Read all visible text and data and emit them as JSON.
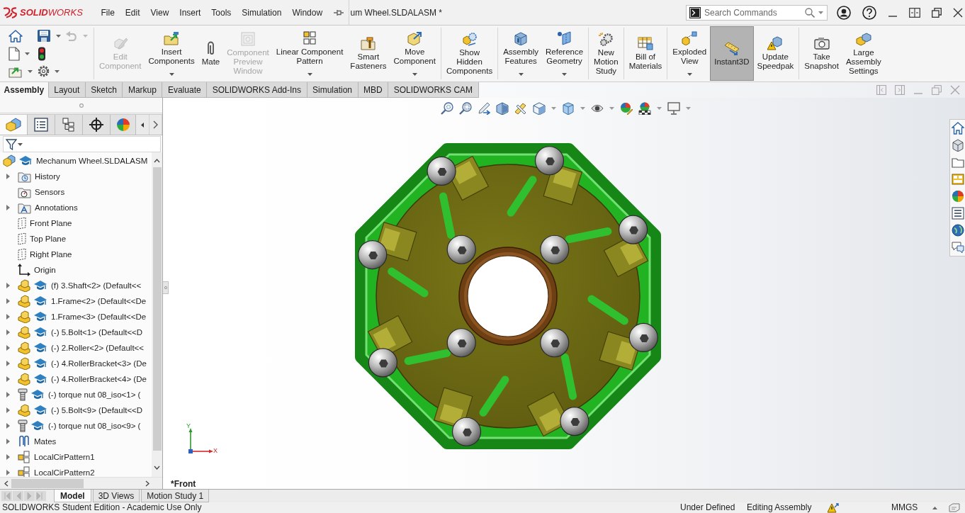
{
  "title_bar": {
    "app_name": "**SOLID**WORKS",
    "menu": [
      "File",
      "Edit",
      "View",
      "Insert",
      "Tools",
      "Simulation",
      "Window"
    ],
    "document_title": "um Wheel.SLDALASM *",
    "search": {
      "placeholder": "Search Commands"
    }
  },
  "quick_access": [
    [
      {
        "has_menu": false,
        "disabled": false
      },
      {
        "has_menu": true,
        "disabled": false
      },
      {
        "has_menu": true,
        "disabled": true
      }
    ],
    [
      {
        "has_menu": true,
        "disabled": false
      },
      {
        "has_menu": false,
        "disabled": false
      }
    ],
    [
      {
        "has_menu": true,
        "disabled": false
      },
      {
        "has_menu": true,
        "disabled": false
      }
    ]
  ],
  "command_groups": [
    [
      {
        "label": "Edit\nComponent",
        "disabled": true,
        "pressed": false,
        "has_menu": false
      },
      {
        "label": "Insert\nComponents",
        "disabled": false,
        "pressed": false,
        "has_menu": true
      },
      {
        "label": "Mate",
        "disabled": false,
        "pressed": false,
        "has_menu": false
      },
      {
        "label": "Component\nPreview\nWindow",
        "disabled": true,
        "pressed": false,
        "has_menu": false
      },
      {
        "label": "Linear Component\nPattern",
        "disabled": false,
        "pressed": false,
        "has_menu": true
      },
      {
        "label": "Smart\nFasteners",
        "disabled": false,
        "pressed": false,
        "has_menu": false
      },
      {
        "label": "Move\nComponent",
        "disabled": false,
        "pressed": false,
        "has_menu": true
      }
    ],
    [
      {
        "label": "Show\nHidden\nComponents",
        "disabled": false,
        "pressed": false,
        "has_menu": false
      }
    ],
    [
      {
        "label": "Assembly\nFeatures",
        "disabled": false,
        "pressed": false,
        "has_menu": true
      },
      {
        "label": "Reference\nGeometry",
        "disabled": false,
        "pressed": false,
        "has_menu": true
      }
    ],
    [
      {
        "label": "New\nMotion\nStudy",
        "disabled": false,
        "pressed": false,
        "has_menu": false
      }
    ],
    [
      {
        "label": "Bill of\nMaterials",
        "disabled": false,
        "pressed": false,
        "has_menu": false
      }
    ],
    [
      {
        "label": "Exploded\nView",
        "disabled": false,
        "pressed": false,
        "has_menu": true
      },
      {
        "label": "Instant3D",
        "disabled": false,
        "pressed": true,
        "has_menu": false
      },
      {
        "label": "Update\nSpeedpak",
        "disabled": false,
        "pressed": false,
        "has_menu": false
      }
    ],
    [
      {
        "label": "Take\nSnapshot",
        "disabled": false,
        "pressed": false,
        "has_menu": false
      },
      {
        "label": "Large\nAssembly\nSettings",
        "disabled": false,
        "pressed": false,
        "has_menu": false
      }
    ]
  ],
  "command_tabs": [
    {
      "label": "Assembly",
      "selected": true
    },
    {
      "label": "Layout",
      "selected": false
    },
    {
      "label": "Sketch",
      "selected": false
    },
    {
      "label": "Markup",
      "selected": false
    },
    {
      "label": "Evaluate",
      "selected": false
    },
    {
      "label": "SOLIDWORKS Add-Ins",
      "selected": false
    },
    {
      "label": "Simulation",
      "selected": false
    },
    {
      "label": "MBD",
      "selected": false
    },
    {
      "label": "SOLIDWORKS CAM",
      "selected": false
    }
  ],
  "feature_manager": {
    "panel_tabs": [
      {
        "selected": true
      },
      {
        "selected": false
      },
      {
        "selected": false
      },
      {
        "selected": false
      },
      {
        "selected": false
      }
    ],
    "tree": {
      "label": "Mechanum Wheel.SLDALASM",
      "kind": "assembly",
      "children": [
        {
          "label": "History",
          "kind": "history",
          "expandable": true
        },
        {
          "label": "Sensors",
          "kind": "sensors",
          "expandable": false
        },
        {
          "label": "Annotations",
          "kind": "annotations",
          "expandable": true
        },
        {
          "label": "Front Plane",
          "kind": "plane",
          "expandable": false
        },
        {
          "label": "Top Plane",
          "kind": "plane",
          "expandable": false
        },
        {
          "label": "Right Plane",
          "kind": "plane",
          "expandable": false
        },
        {
          "label": "Origin",
          "kind": "origin",
          "expandable": false
        },
        {
          "label": "(f) 3.Shaft<2> (Default<<",
          "kind": "part",
          "expandable": true
        },
        {
          "label": "1.Frame<2> (Default<<De",
          "kind": "part",
          "expandable": true
        },
        {
          "label": "1.Frame<3> (Default<<De",
          "kind": "part",
          "expandable": true
        },
        {
          "label": "(-) 5.Bolt<1> (Default<<D",
          "kind": "part",
          "expandable": true
        },
        {
          "label": "(-) 2.Roller<2> (Default<<",
          "kind": "part",
          "expandable": true
        },
        {
          "label": "(-) 4.RollerBracket<3> (De",
          "kind": "part",
          "expandable": true
        },
        {
          "label": "(-) 4.RollerBracket<4> (De",
          "kind": "part",
          "expandable": true
        },
        {
          "label": "(-) torque nut 08_iso<1> (",
          "kind": "hardware",
          "expandable": true
        },
        {
          "label": "(-) 5.Bolt<9> (Default<<D",
          "kind": "part",
          "expandable": true
        },
        {
          "label": "(-) torque nut 08_iso<9> (",
          "kind": "hardware",
          "expandable": true
        },
        {
          "label": "Mates",
          "kind": "mates",
          "expandable": true
        },
        {
          "label": "LocalCirPattern1",
          "kind": "pattern",
          "expandable": true
        },
        {
          "label": "LocalCirPattern2",
          "kind": "pattern",
          "expandable": true
        }
      ]
    }
  },
  "bottom_tabs": [
    {
      "label": "Model",
      "selected": true
    },
    {
      "label": "3D Views",
      "selected": false
    },
    {
      "label": "Motion Study 1",
      "selected": false
    }
  ],
  "viewport": {
    "view_name": "*Front",
    "triad": {
      "y_label": "Y",
      "x_label": "X"
    }
  },
  "status_bar": {
    "edition": "SOLIDWORKS Student Edition - Academic Use Only",
    "states": [
      "Under Defined",
      "Editing Assembly"
    ],
    "units": "MMGS"
  }
}
